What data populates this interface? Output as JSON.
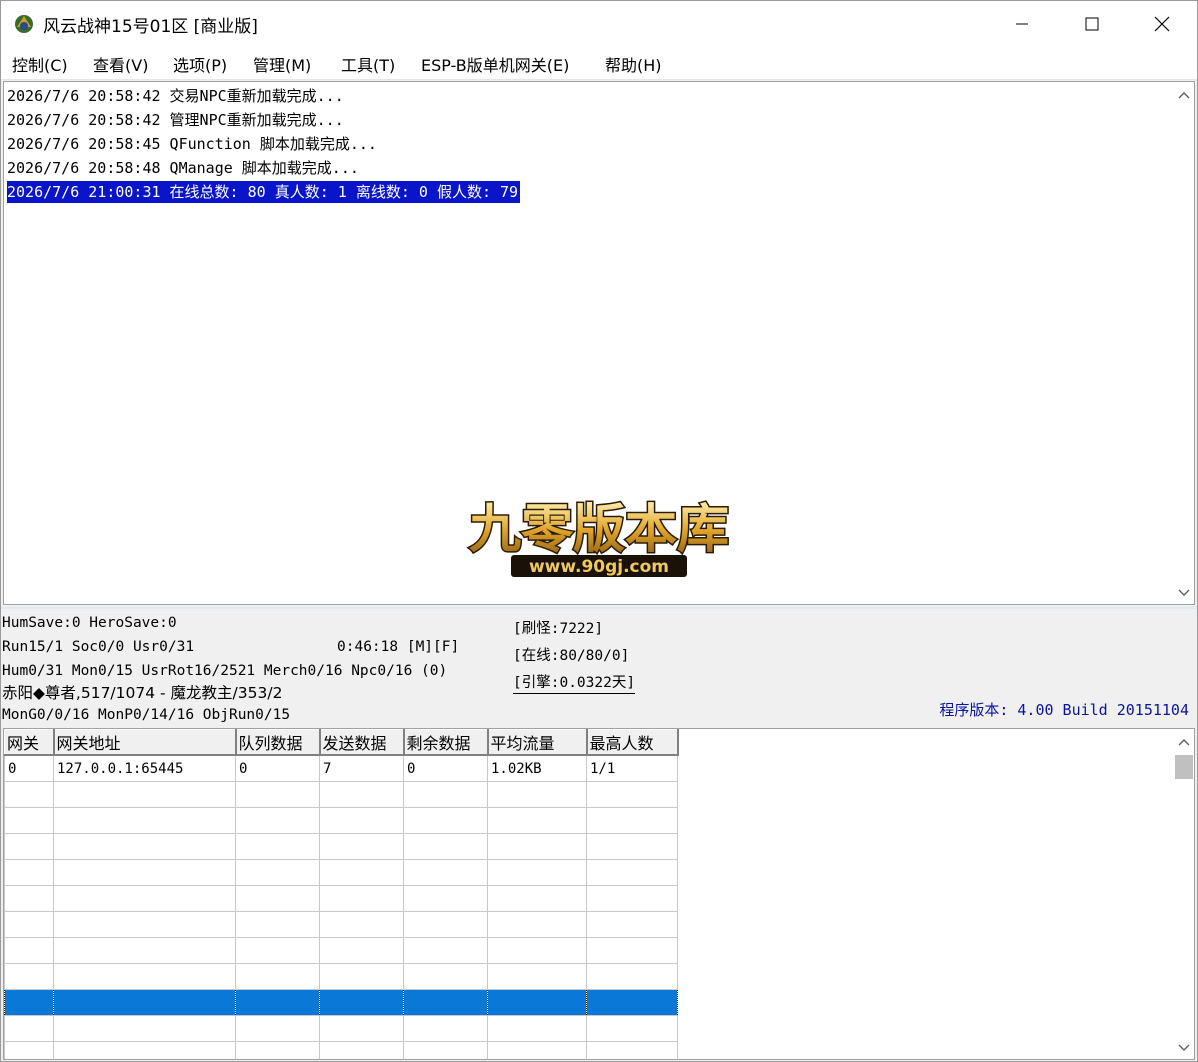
{
  "window": {
    "title": "风云战神15号01区 [商业版]"
  },
  "menu": [
    "控制(C)",
    "查看(V)",
    "选项(P)",
    "管理(M)",
    "工具(T)",
    "ESP-B版单机网关(E)",
    "帮助(H)"
  ],
  "log": [
    "2026/7/6 20:58:42 交易NPC重新加载完成...",
    "2026/7/6 20:58:42 管理NPC重新加载完成...",
    "2026/7/6 20:58:45 QFunction 脚本加载完成...",
    "2026/7/6 20:58:48 QManage 脚本加载完成...",
    "2026/7/6 21:00:31 在线总数: 80 真人数: 1 离线数: 0 假人数: 79"
  ],
  "watermark": {
    "title": "九零版本库",
    "url": "www.90gj.com"
  },
  "status": {
    "line1": "HumSave:0 HeroSave:0",
    "line2": "Run15/1 Soc0/0 Usr0/31",
    "time": "0:46:18 [M][F]",
    "line3": "Hum0/31 Mon0/15 UsrRot16/2521 Merch0/16 Npc0/16 (0)",
    "line4": "赤阳◆尊者,517/1074 - 魔龙教主/353/2",
    "line5": "MonG0/0/16 MonP0/14/16 ObjRun0/15",
    "refresh": "[刷怪:7222]",
    "online": "[在线:80/80/0]",
    "engine": "[引擎:0.0322天]",
    "version": "程序版本: 4.00 Build 20151104"
  },
  "grid": {
    "headers": [
      "网关",
      "网关地址",
      "队列数据",
      "发送数据",
      "剩余数据",
      "平均流量",
      "最高人数"
    ],
    "rows": [
      [
        "0",
        "127.0.0.1:65445",
        "0",
        "7",
        "0",
        "1.02KB",
        "1/1"
      ]
    ]
  },
  "colors": {
    "selection": "#0a14c8",
    "grid_selection": "#0a78d7",
    "version_text": "#0a14a0"
  }
}
